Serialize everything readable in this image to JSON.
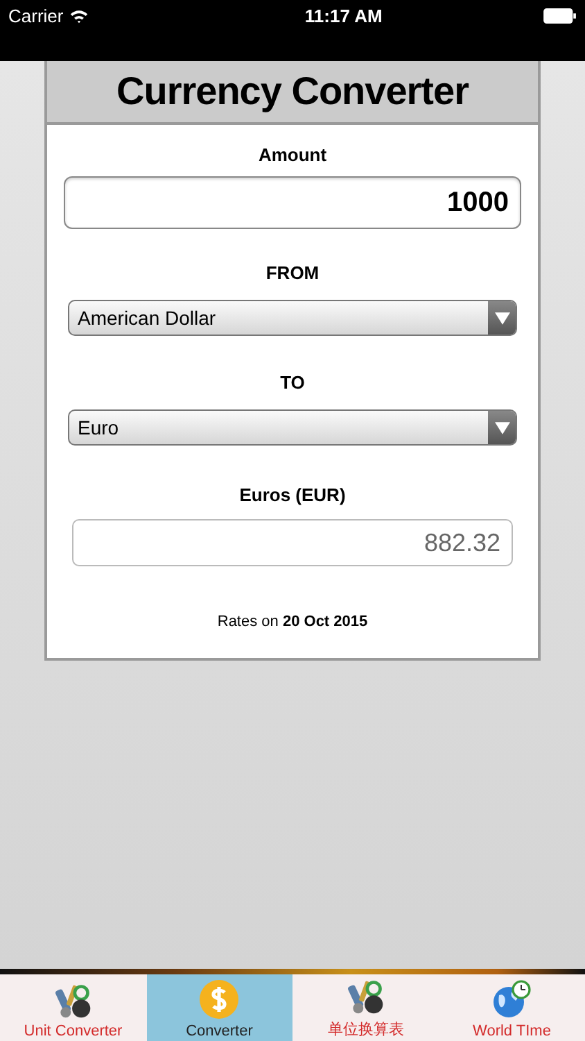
{
  "status_bar": {
    "carrier": "Carrier",
    "time": "11:17 AM"
  },
  "title": "Currency Converter",
  "amount": {
    "label": "Amount",
    "value": "1000"
  },
  "from": {
    "label": "FROM",
    "value": "American Dollar"
  },
  "to": {
    "label": "TO",
    "value": "Euro"
  },
  "result": {
    "label": "Euros (EUR)",
    "value": "882.32"
  },
  "rates_note": "Rates on **20 Oct 2015**",
  "tabs": [
    {
      "label": "Unit Converter",
      "kind": "tools",
      "selected": false
    },
    {
      "label": "Converter",
      "kind": "dollar",
      "selected": true
    },
    {
      "label": "单位换算表",
      "kind": "tools",
      "selected": false
    },
    {
      "label": "World TIme",
      "kind": "globe",
      "selected": false
    }
  ]
}
